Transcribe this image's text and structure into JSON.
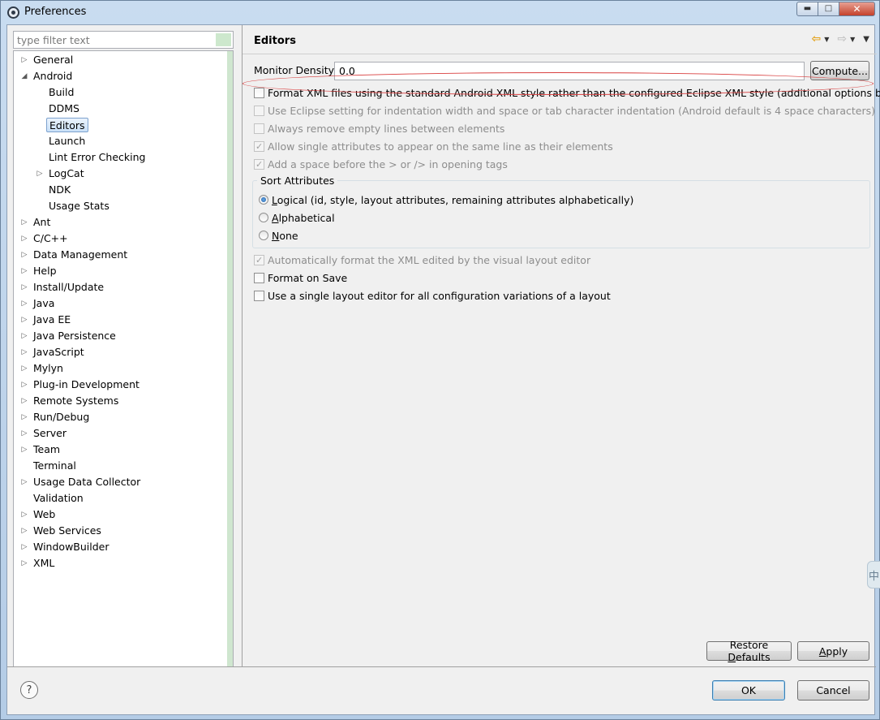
{
  "window": {
    "title": "Preferences",
    "minimize": "0",
    "maximize": "1",
    "close": "r"
  },
  "filter": {
    "placeholder": "type filter text"
  },
  "tree": {
    "items": [
      {
        "label": "General",
        "level": 0,
        "expander": "collapsed"
      },
      {
        "label": "Android",
        "level": 0,
        "expander": "expanded"
      },
      {
        "label": "Build",
        "level": 1,
        "expander": "none"
      },
      {
        "label": "DDMS",
        "level": 1,
        "expander": "none"
      },
      {
        "label": "Editors",
        "level": 1,
        "expander": "none",
        "selected": true
      },
      {
        "label": "Launch",
        "level": 1,
        "expander": "none"
      },
      {
        "label": "Lint Error Checking",
        "level": 1,
        "expander": "none"
      },
      {
        "label": "LogCat",
        "level": 1,
        "expander": "collapsed"
      },
      {
        "label": "NDK",
        "level": 1,
        "expander": "none"
      },
      {
        "label": "Usage Stats",
        "level": 1,
        "expander": "none"
      },
      {
        "label": "Ant",
        "level": 0,
        "expander": "collapsed"
      },
      {
        "label": "C/C++",
        "level": 0,
        "expander": "collapsed"
      },
      {
        "label": "Data Management",
        "level": 0,
        "expander": "collapsed"
      },
      {
        "label": "Help",
        "level": 0,
        "expander": "collapsed"
      },
      {
        "label": "Install/Update",
        "level": 0,
        "expander": "collapsed"
      },
      {
        "label": "Java",
        "level": 0,
        "expander": "collapsed"
      },
      {
        "label": "Java EE",
        "level": 0,
        "expander": "collapsed"
      },
      {
        "label": "Java Persistence",
        "level": 0,
        "expander": "collapsed"
      },
      {
        "label": "JavaScript",
        "level": 0,
        "expander": "collapsed"
      },
      {
        "label": "Mylyn",
        "level": 0,
        "expander": "collapsed"
      },
      {
        "label": "Plug-in Development",
        "level": 0,
        "expander": "collapsed"
      },
      {
        "label": "Remote Systems",
        "level": 0,
        "expander": "collapsed"
      },
      {
        "label": "Run/Debug",
        "level": 0,
        "expander": "collapsed"
      },
      {
        "label": "Server",
        "level": 0,
        "expander": "collapsed"
      },
      {
        "label": "Team",
        "level": 0,
        "expander": "collapsed"
      },
      {
        "label": "Terminal",
        "level": 0,
        "expander": "none"
      },
      {
        "label": "Usage Data Collector",
        "level": 0,
        "expander": "collapsed"
      },
      {
        "label": "Validation",
        "level": 0,
        "expander": "none"
      },
      {
        "label": "Web",
        "level": 0,
        "expander": "collapsed"
      },
      {
        "label": "Web Services",
        "level": 0,
        "expander": "collapsed"
      },
      {
        "label": "WindowBuilder",
        "level": 0,
        "expander": "collapsed"
      },
      {
        "label": "XML",
        "level": 0,
        "expander": "collapsed"
      }
    ]
  },
  "page": {
    "title": "Editors",
    "monitor_density_label": "Monitor Density",
    "monitor_density_value": "0.0",
    "compute_label": "Compute...",
    "options": [
      {
        "label": "Format XML files using the standard Android XML style rather than the configured Eclipse XML style (additional options below)",
        "checked": false,
        "enabled": true
      },
      {
        "label": "Use Eclipse setting for indentation width and space or tab character indentation (Android default is 4 space characters)",
        "checked": false,
        "enabled": false
      },
      {
        "label": "Always remove empty lines between elements",
        "checked": false,
        "enabled": false
      },
      {
        "label": "Allow single attributes to appear on the same line as their elements",
        "checked": true,
        "enabled": false
      },
      {
        "label": "Add a space before the > or /> in opening tags",
        "checked": true,
        "enabled": false
      }
    ],
    "sort_group_title": "Sort Attributes",
    "sort_options": [
      {
        "label": "Logical (id, style, layout attributes, remaining attributes alphabetically)",
        "selected": true
      },
      {
        "label": "Alphabetical",
        "selected": false
      },
      {
        "label": "None",
        "selected": false
      }
    ],
    "options2": [
      {
        "label": "Automatically format the XML edited by the visual layout editor",
        "checked": true,
        "enabled": false
      },
      {
        "label": "Format on Save",
        "checked": false,
        "enabled": true
      },
      {
        "label": "Use a single layout editor for all configuration variations of a layout",
        "checked": false,
        "enabled": true
      }
    ],
    "restore_defaults_label": "Restore Defaults",
    "apply_label": "Apply"
  },
  "footer": {
    "help_icon": "?",
    "ok_label": "OK",
    "cancel_label": "Cancel"
  },
  "side_tab": {
    "label": "中"
  },
  "colors": {
    "highlight": "#d94040",
    "selection_border": "#7da2ce",
    "accent_green": "#cfe6cf"
  }
}
